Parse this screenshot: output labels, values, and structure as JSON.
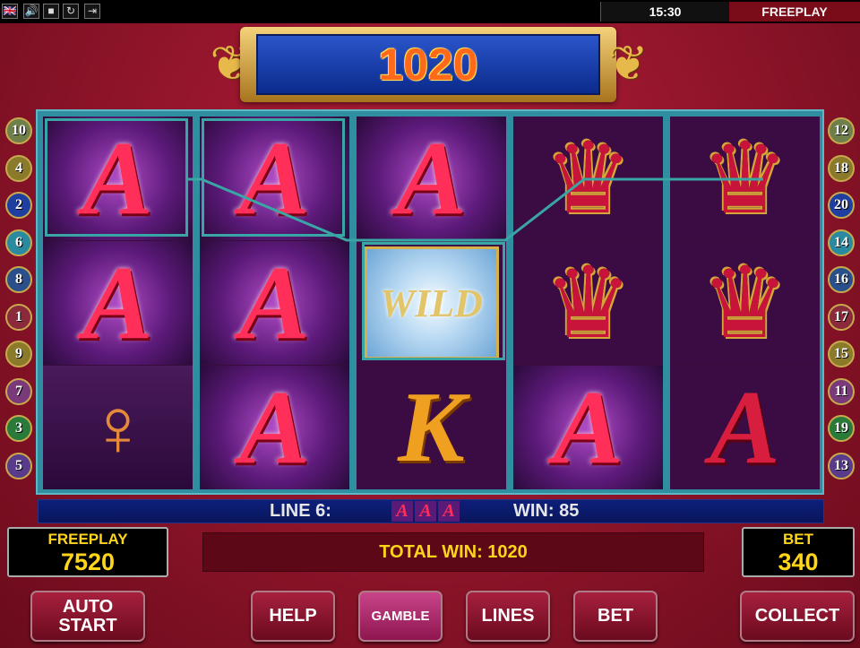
{
  "top_bar": {
    "icons": [
      "uk-flag-icon",
      "speaker-icon",
      "fullscreen-icon",
      "refresh-icon",
      "exit-icon"
    ],
    "flag_glyph": "🇬🇧",
    "speaker_glyph": "🔊",
    "fullscreen_glyph": "■",
    "refresh_glyph": "↻",
    "exit_glyph": "⇥",
    "clock": "15:30",
    "mode_label": "FREEPLAY"
  },
  "jackpot": {
    "value": "1020"
  },
  "left_lines": [
    "10",
    "4",
    "2",
    "6",
    "8",
    "1",
    "9",
    "7",
    "3",
    "5"
  ],
  "right_lines": [
    "12",
    "18",
    "20",
    "14",
    "16",
    "17",
    "15",
    "11",
    "19",
    "13"
  ],
  "reels": [
    [
      "A",
      "A",
      "lady"
    ],
    [
      "A",
      "A",
      "A"
    ],
    [
      "A",
      "wild",
      "K"
    ],
    [
      "crown",
      "crown",
      "A"
    ],
    [
      "crown",
      "crown",
      "A-plain"
    ]
  ],
  "symbol_glyphs": {
    "A": "A",
    "K": "K",
    "crown": "♛",
    "lady": "♀",
    "wild": "WILD"
  },
  "info_strip": {
    "line_label": "LINE 6:",
    "mini_symbols": [
      "A",
      "A",
      "A"
    ],
    "win_label": "WIN: 85"
  },
  "freeplay_meter": {
    "label": "FREEPLAY",
    "value": "7520"
  },
  "total_win": "TOTAL WIN: 1020",
  "bet_meter": {
    "label": "BET",
    "value": "340"
  },
  "buttons": {
    "auto_start_line1": "AUTO",
    "auto_start_line2": "START",
    "help": "HELP",
    "gamble": "GAMBLE",
    "lines": "LINES",
    "bet": "BET",
    "collect": "COLLECT"
  },
  "colors": {
    "accent_yellow": "#ffd51a",
    "jackpot_orange": "#ff6a1a",
    "reel_frame": "#2f8ea0"
  }
}
